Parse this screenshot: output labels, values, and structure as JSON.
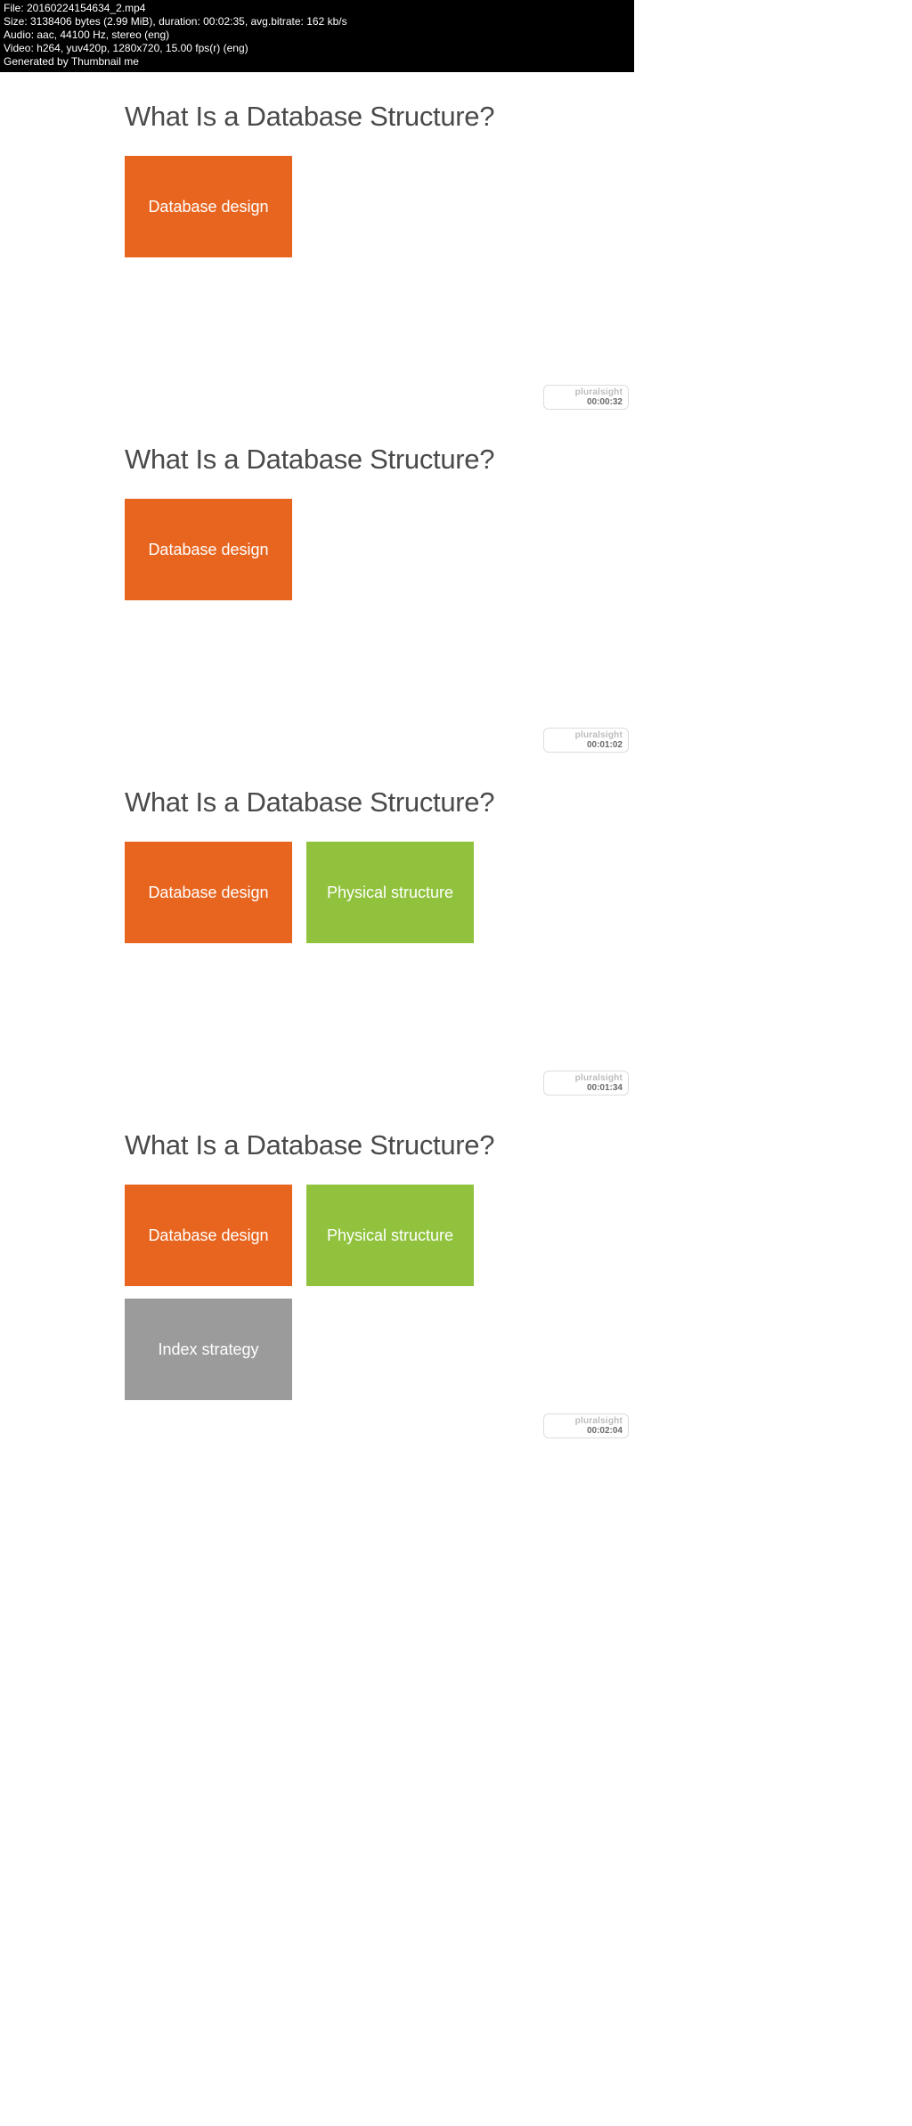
{
  "meta": {
    "file": "File: 20160224154634_2.mp4",
    "size": "Size: 3138406 bytes (2.99 MiB), duration: 00:02:35, avg.bitrate: 162 kb/s",
    "audio": "Audio: aac, 44100 Hz, stereo (eng)",
    "video": "Video: h264, yuv420p, 1280x720, 15.00 fps(r) (eng)",
    "generator": "Generated by Thumbnail me"
  },
  "brand": "pluralsight",
  "frames": [
    {
      "title": "What Is a Database Structure?",
      "timestamp": "00:00:32",
      "pills": [
        {
          "label": "Database design",
          "color": "orange"
        }
      ]
    },
    {
      "title": "What Is a Database Structure?",
      "timestamp": "00:01:02",
      "pills": [
        {
          "label": "Database design",
          "color": "orange"
        }
      ]
    },
    {
      "title": "What Is a Database Structure?",
      "timestamp": "00:01:34",
      "pills": [
        {
          "label": "Database design",
          "color": "orange"
        },
        {
          "label": "Physical structure",
          "color": "green"
        }
      ]
    },
    {
      "title": "What Is a Database Structure?",
      "timestamp": "00:02:04",
      "pills": [
        {
          "label": "Database design",
          "color": "orange"
        },
        {
          "label": "Physical structure",
          "color": "green"
        },
        {
          "label": "Index strategy",
          "color": "grey"
        }
      ]
    }
  ]
}
